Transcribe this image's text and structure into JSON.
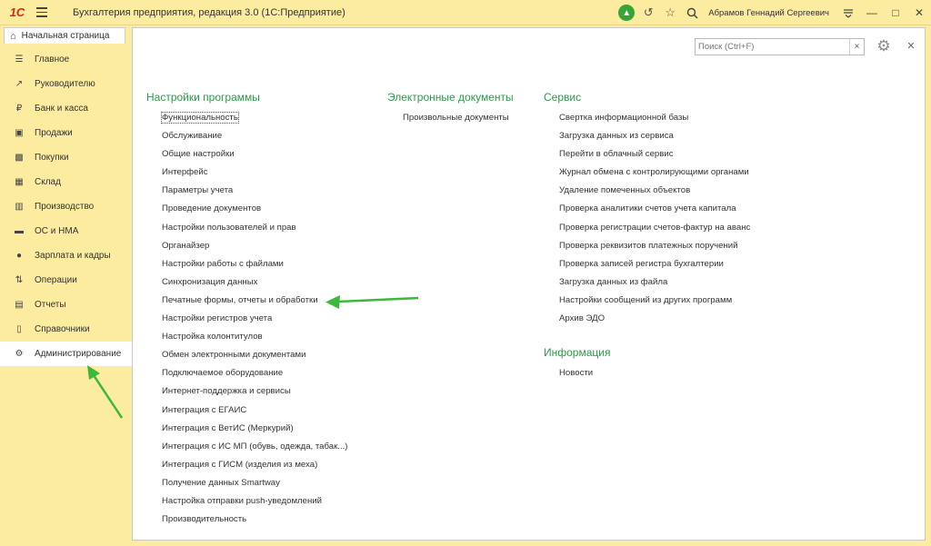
{
  "app": {
    "logo": "1С",
    "title": "Бухгалтерия предприятия, редакция 3.0  (1С:Предприятие)",
    "user": "Абрамов Геннадий Сергеевич"
  },
  "home_tab": {
    "label": "Начальная страница"
  },
  "sidebar": {
    "items": [
      {
        "label": "Главное",
        "icon": "menu-lines-icon"
      },
      {
        "label": "Руководителю",
        "icon": "trend-icon"
      },
      {
        "label": "Банк и касса",
        "icon": "ruble-coin-icon"
      },
      {
        "label": "Продажи",
        "icon": "shopping-bag-icon"
      },
      {
        "label": "Покупки",
        "icon": "cart-icon"
      },
      {
        "label": "Склад",
        "icon": "warehouse-grid-icon"
      },
      {
        "label": "Производство",
        "icon": "factory-icon"
      },
      {
        "label": "ОС и НМА",
        "icon": "truck-icon"
      },
      {
        "label": "Зарплата и кадры",
        "icon": "person-icon"
      },
      {
        "label": "Операции",
        "icon": "dt-kt-icon"
      },
      {
        "label": "Отчеты",
        "icon": "bar-chart-icon"
      },
      {
        "label": "Справочники",
        "icon": "book-icon"
      },
      {
        "label": "Администрирование",
        "icon": "gear-icon",
        "active": true
      }
    ]
  },
  "search": {
    "placeholder": "Поиск (Ctrl+F)"
  },
  "sections": {
    "settings": {
      "title": "Настройки программы",
      "items": [
        "Функциональность",
        "Обслуживание",
        "Общие настройки",
        "Интерфейс",
        "Параметры учета",
        "Проведение документов",
        "Настройки пользователей и прав",
        "Органайзер",
        "Настройки работы с файлами",
        "Синхронизация данных",
        "Печатные формы, отчеты и обработки",
        "Настройки регистров учета",
        "Настройка колонтитулов",
        "Обмен электронными документами",
        "Подключаемое оборудование",
        "Интернет-поддержка и сервисы",
        "Интеграция с ЕГАИС",
        "Интеграция с ВетИС (Меркурий)",
        "Интеграция с ИС МП (обувь, одежда, табак...)",
        "Интеграция с ГИСМ (изделия из меха)",
        "Получение данных Smartway",
        "Настройка отправки push-уведомлений",
        "Производительность"
      ]
    },
    "edocs": {
      "title": "Электронные документы",
      "items": [
        "Произвольные документы"
      ]
    },
    "service": {
      "title": "Сервис",
      "items": [
        "Свертка информационной базы",
        "Загрузка данных из сервиса",
        "Перейти в облачный сервис",
        "Журнал обмена с контролирующими органами",
        "Удаление помеченных объектов",
        "Проверка аналитики счетов учета капитала",
        "Проверка регистрации счетов-фактур на аванс",
        "Проверка реквизитов платежных поручений",
        "Проверка записей регистра бухгалтерии",
        "Загрузка данных из файла",
        "Настройки сообщений из других программ",
        "Архив ЭДО"
      ]
    },
    "info": {
      "title": "Информация",
      "items": [
        "Новости"
      ]
    }
  },
  "colors": {
    "section_header": "#2c9a4b",
    "sidebar_bg": "#fbeca0",
    "annotation_arrow": "#3cb83a",
    "notification": "#3aa537"
  }
}
